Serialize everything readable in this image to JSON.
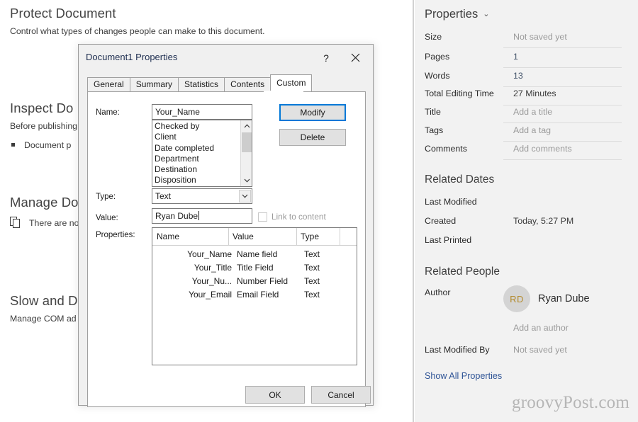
{
  "backdrop": {
    "sections": [
      {
        "heading": "Protect Document",
        "desc": "Control what types of changes people can make to this document."
      },
      {
        "heading": "Inspect Do",
        "desc": "Before publishing",
        "bullet": "Document p"
      },
      {
        "heading": "Manage Do",
        "icon_row": "There are no"
      },
      {
        "heading": "Slow and D",
        "desc": "Manage COM ad"
      }
    ]
  },
  "properties_panel": {
    "title": "Properties",
    "chevron_icon": "chevron-down-icon",
    "rows": [
      {
        "label": "Size",
        "value": "Not saved yet",
        "style": "placeholder"
      },
      {
        "label": "Pages",
        "value": "1",
        "style": "value"
      },
      {
        "label": "Words",
        "value": "13",
        "style": "value"
      },
      {
        "label": "Total Editing Time",
        "value": "27 Minutes",
        "style": "dark"
      },
      {
        "label": "Title",
        "value": "Add a title",
        "style": "placeholder"
      },
      {
        "label": "Tags",
        "value": "Add a tag",
        "style": "placeholder"
      },
      {
        "label": "Comments",
        "value": "Add comments",
        "style": "placeholder"
      }
    ],
    "related_dates": {
      "heading": "Related Dates",
      "rows": [
        {
          "label": "Last Modified",
          "value": ""
        },
        {
          "label": "Created",
          "value": "Today, 5:27 PM"
        },
        {
          "label": "Last Printed",
          "value": ""
        }
      ]
    },
    "related_people": {
      "heading": "Related People",
      "author_label": "Author",
      "author_initials": "RD",
      "author_name": "Ryan Dube",
      "add_author": "Add an author",
      "last_modified_by_label": "Last Modified By",
      "last_modified_by_value": "Not saved yet"
    },
    "show_all_link": "Show All Properties",
    "watermark": "groovyPost.com"
  },
  "dialog": {
    "title": "Document1 Properties",
    "help_icon": "?",
    "close_icon": "close-icon",
    "tabs": [
      {
        "label": "General",
        "active": false
      },
      {
        "label": "Summary",
        "active": false
      },
      {
        "label": "Statistics",
        "active": false
      },
      {
        "label": "Contents",
        "active": false
      },
      {
        "label": "Custom",
        "active": true
      }
    ],
    "name_label": "Name:",
    "name_value": "Your_Name",
    "name_suggestions": [
      "Checked by",
      "Client",
      "Date completed",
      "Department",
      "Destination",
      "Disposition"
    ],
    "type_label": "Type:",
    "type_value": "Text",
    "value_label": "Value:",
    "value_value": "Ryan Dube",
    "link_to_content_label": "Link to content",
    "link_to_content_checked": false,
    "properties_label": "Properties:",
    "modify_label": "Modify",
    "delete_label": "Delete",
    "grid": {
      "columns": [
        "Name",
        "Value",
        "Type"
      ],
      "rows": [
        {
          "name": "Your_Name",
          "value": "Name field",
          "type": "Text"
        },
        {
          "name": "Your_Title",
          "value": "Title Field",
          "type": "Text"
        },
        {
          "name": "Your_Nu...",
          "value": "Number Field",
          "type": "Text"
        },
        {
          "name": "Your_Email",
          "value": "Email Field",
          "type": "Text"
        }
      ]
    },
    "ok_label": "OK",
    "cancel_label": "Cancel"
  },
  "colors": {
    "accent": "#0078d7",
    "link": "#2f5496",
    "panel_bg": "#f2f2f2",
    "value_text": "#44546a"
  }
}
